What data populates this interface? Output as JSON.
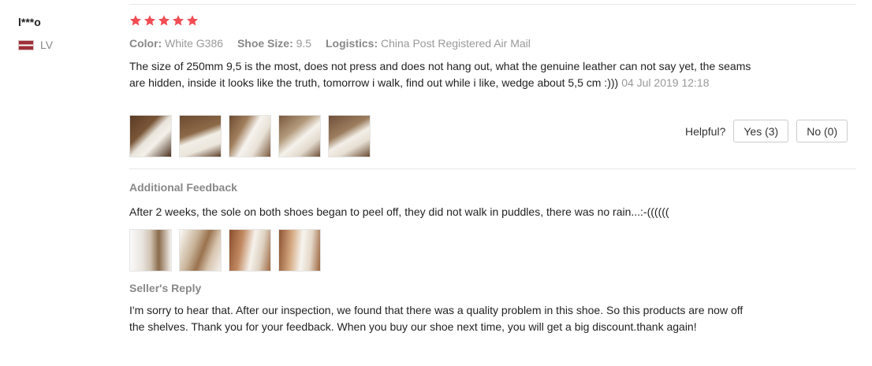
{
  "reviewer": {
    "name": "l***o",
    "country": "LV",
    "flag": "latvia-flag-icon"
  },
  "rating": {
    "stars": 5,
    "max": 5,
    "color": "#f14d54"
  },
  "meta": {
    "color_label": "Color:",
    "color_value": "White G386",
    "size_label": "Shoe Size:",
    "size_value": "9.5",
    "logistics_label": "Logistics:",
    "logistics_value": "China Post Registered Air Mail"
  },
  "review": {
    "text": "The size of 250mm 9,5 is the most, does not press and does not hang out, what the genuine leather can not say yet, the seams are hidden, inside it looks like the truth, tomorrow i walk, find out while i like, wedge about 5,5 cm :)))",
    "date": "04 Jul 2019 12:18"
  },
  "photos": [
    "shoe-photo-1",
    "shoe-photo-2",
    "shoe-photo-3",
    "shoe-photo-4",
    "shoe-photo-5"
  ],
  "helpful": {
    "label": "Helpful?",
    "yes": "Yes (3)",
    "no": "No (0)"
  },
  "additional": {
    "heading": "Additional Feedback",
    "text": "After 2 weeks, the sole on both shoes began to peel off, they did not walk in puddles, there was no rain...:-((((((",
    "photos": [
      "sole-photo-1",
      "sole-photo-2",
      "sole-photo-3",
      "sole-photo-4"
    ]
  },
  "seller_reply": {
    "heading": "Seller's Reply",
    "text": "I'm sorry to hear that. After our inspection, we found that there was a quality problem in this shoe. So this products are now off the shelves. Thank you for your feedback. When you buy our shoe next time, you will get a big discount.thank again!"
  }
}
